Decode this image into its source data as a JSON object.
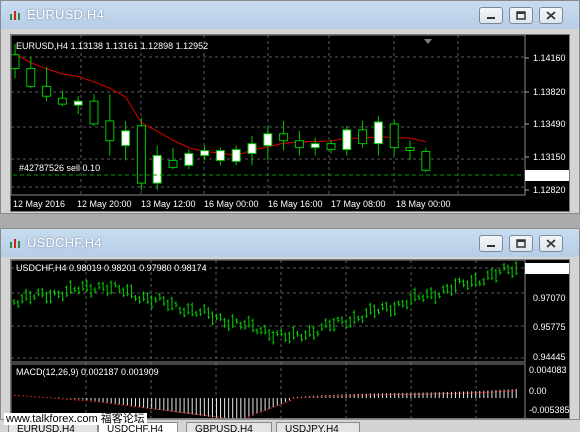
{
  "windows": [
    {
      "title": "EURUSD,H4",
      "header": "EURUSD,H4  1.13138 1.13161 1.12898 1.12952",
      "order_label": "#42787526 sell 0.10",
      "price_axis": [
        "1.14160",
        "1.13820",
        "1.13490",
        "1.13150",
        "1.12952",
        "1.12820"
      ],
      "time_axis": [
        "12 May 2016",
        "12 May 20:00",
        "13 May 12:00",
        "16 May 00:00",
        "16 May 16:00",
        "17 May 08:00",
        "18 May 00:00"
      ],
      "colors": {
        "bull_candle": "#ffffff",
        "bear_candle": "#000000",
        "outline": "#00c800",
        "moving_average": "#e00000",
        "grid": "#6a6a6a",
        "order_line": "#00a000"
      },
      "candles": [
        {
          "o": 1.1412,
          "h": 1.1423,
          "l": 1.1388,
          "c": 1.1398
        },
        {
          "o": 1.1398,
          "h": 1.141,
          "l": 1.1378,
          "c": 1.138
        },
        {
          "o": 1.138,
          "h": 1.14,
          "l": 1.1365,
          "c": 1.137
        },
        {
          "o": 1.1368,
          "h": 1.1376,
          "l": 1.136,
          "c": 1.1362
        },
        {
          "o": 1.1361,
          "h": 1.137,
          "l": 1.1352,
          "c": 1.1365
        },
        {
          "o": 1.1365,
          "h": 1.1372,
          "l": 1.134,
          "c": 1.1342
        },
        {
          "o": 1.1345,
          "h": 1.1372,
          "l": 1.131,
          "c": 1.1325
        },
        {
          "o": 1.132,
          "h": 1.1345,
          "l": 1.1305,
          "c": 1.1335
        },
        {
          "o": 1.134,
          "h": 1.1348,
          "l": 1.1275,
          "c": 1.1282
        },
        {
          "o": 1.1282,
          "h": 1.132,
          "l": 1.1275,
          "c": 1.131
        },
        {
          "o": 1.1305,
          "h": 1.1318,
          "l": 1.1296,
          "c": 1.1298
        },
        {
          "o": 1.13,
          "h": 1.1316,
          "l": 1.1296,
          "c": 1.1312
        },
        {
          "o": 1.131,
          "h": 1.132,
          "l": 1.1305,
          "c": 1.1315
        },
        {
          "o": 1.1305,
          "h": 1.1318,
          "l": 1.13,
          "c": 1.1315
        },
        {
          "o": 1.1304,
          "h": 1.132,
          "l": 1.13,
          "c": 1.1316
        },
        {
          "o": 1.1312,
          "h": 1.133,
          "l": 1.13,
          "c": 1.1322
        },
        {
          "o": 1.132,
          "h": 1.134,
          "l": 1.1305,
          "c": 1.1332
        },
        {
          "o": 1.1332,
          "h": 1.1345,
          "l": 1.1315,
          "c": 1.1325
        },
        {
          "o": 1.1325,
          "h": 1.1335,
          "l": 1.131,
          "c": 1.1318
        },
        {
          "o": 1.1318,
          "h": 1.1328,
          "l": 1.131,
          "c": 1.1322
        },
        {
          "o": 1.1322,
          "h": 1.1326,
          "l": 1.1312,
          "c": 1.1316
        },
        {
          "o": 1.1316,
          "h": 1.134,
          "l": 1.131,
          "c": 1.1336
        },
        {
          "o": 1.1336,
          "h": 1.1345,
          "l": 1.1318,
          "c": 1.1322
        },
        {
          "o": 1.1322,
          "h": 1.135,
          "l": 1.131,
          "c": 1.1344
        },
        {
          "o": 1.1342,
          "h": 1.1346,
          "l": 1.131,
          "c": 1.1318
        },
        {
          "o": 1.1318,
          "h": 1.1325,
          "l": 1.1305,
          "c": 1.1315
        },
        {
          "o": 1.1314,
          "h": 1.1318,
          "l": 1.1293,
          "c": 1.1295
        }
      ]
    },
    {
      "title": "USDCHF,H4",
      "header": "USDCHF,H4  0.98019 0.98201 0.97980 0.98174",
      "price_axis": [
        "0.98174",
        "0.97070",
        "0.95775",
        "0.94445"
      ],
      "macd_label": "MACD(12,26,9) 0.002187 0.001909",
      "macd_axis": [
        "0.004083",
        "0.00",
        "-0.005385"
      ]
    }
  ],
  "tabs": [
    "EURUSD,H4",
    "USDCHF,H4",
    "GBPUSD,H4",
    "USDJPY,H4"
  ],
  "active_tab": "USDCHF,H4",
  "watermark": "www.talkforex.com 福客论坛"
}
